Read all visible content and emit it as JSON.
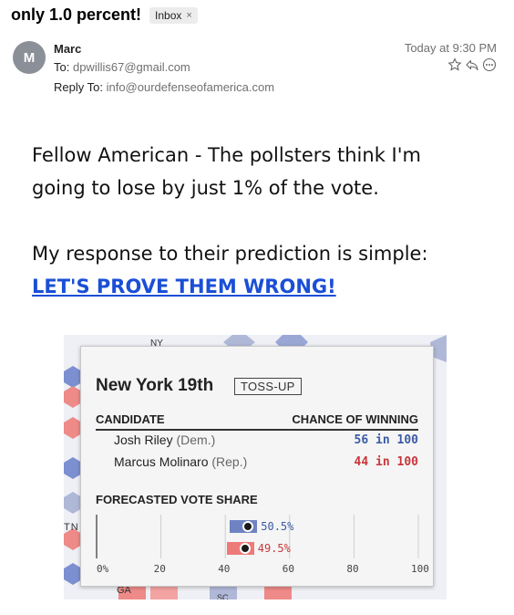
{
  "email": {
    "subject": "only 1.0 percent!",
    "folder_badge": "Inbox",
    "badge_close": "×",
    "avatar_initial": "M",
    "sender": "Marc",
    "to_label": "To:",
    "to_address": "dpwillis67@gmail.com",
    "reply_to_label": "Reply To:",
    "reply_to_address": "info@ourdefenseofamerica.com",
    "timestamp": "Today at 9:30 PM",
    "action_icons": [
      "star-icon",
      "reply-icon",
      "more-icon"
    ]
  },
  "body": {
    "line1": "Fellow American - The pollsters think I'm",
    "line2": "going to lose by just 1% of the vote.",
    "line3": "My response to their prediction is simple:",
    "cta": "LET'S PROVE THEM WRONG!"
  },
  "forecast": {
    "district": "New York 19th",
    "rating": "TOSS-UP",
    "col_candidate": "CANDIDATE",
    "col_chance": "CHANCE OF WINNING",
    "candidates": [
      {
        "name": "Josh Riley",
        "party": "(Dem.)",
        "chance": "56 in 100",
        "color": "#3b5aa6"
      },
      {
        "name": "Marcus Molinaro",
        "party": "(Rep.)",
        "chance": "44 in 100",
        "color": "#c8363a"
      }
    ],
    "vote_share_title": "FORECASTED VOTE SHARE"
  },
  "chart_data": {
    "type": "bar",
    "title": "FORECASTED VOTE SHARE",
    "xlim": [
      0,
      100
    ],
    "ticks": [
      "0%",
      "20",
      "40",
      "60",
      "80",
      "100"
    ],
    "series": [
      {
        "name": "Josh Riley",
        "value": 50.5,
        "label": "50.5%",
        "color": "#6f83c2"
      },
      {
        "name": "Marcus Molinaro",
        "value": 49.5,
        "label": "49.5%",
        "color": "#ee7a78"
      }
    ]
  },
  "map_fragments": {
    "top_label": "NY",
    "left_label": "TN",
    "bottom_label": "GA",
    "bottom_right_label": "SC"
  },
  "colors": {
    "link": "#1a4fd6",
    "dem": "#3b5aa6",
    "rep": "#c8363a",
    "dem_bar": "#6f83c2",
    "rep_bar": "#ee7a78"
  }
}
